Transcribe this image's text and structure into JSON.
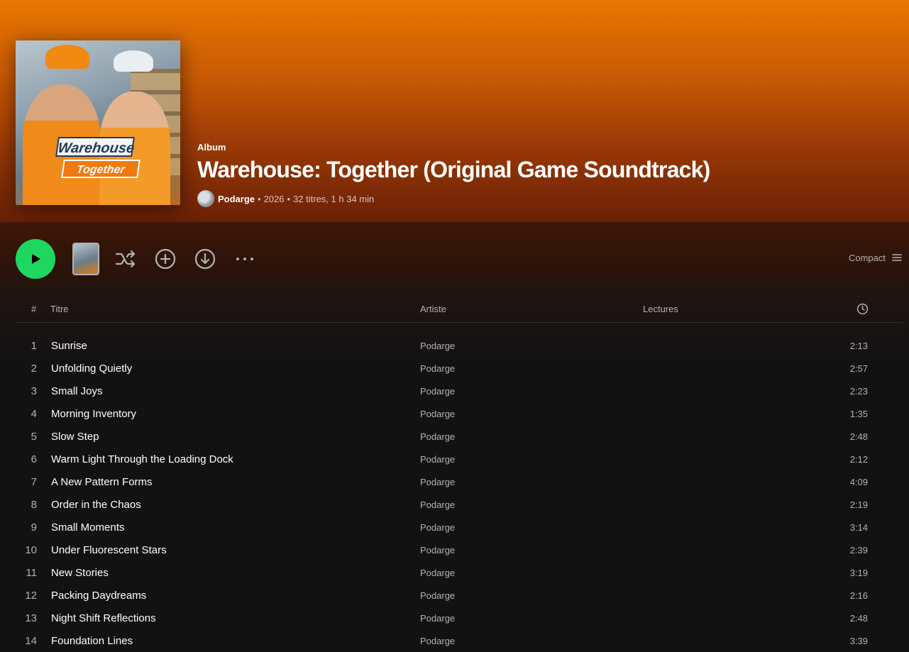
{
  "album": {
    "type_label": "Album",
    "title": "Warehouse: Together (Original Game Soundtrack)",
    "artist": "Podarge",
    "year": "2026",
    "summary": "32 titres, 1 h 34 min",
    "separator": "•",
    "cover_text_line1": "Warehouse",
    "cover_text_line2": "Together"
  },
  "actions": {
    "play_icon": "play-icon",
    "shuffle_icon": "shuffle-icon",
    "add_icon": "add-circle-icon",
    "download_icon": "download-icon",
    "more_icon": "more-horizontal-icon",
    "view_mode_label": "Compact",
    "accent_color": "#1ed760"
  },
  "table": {
    "headers": {
      "num": "#",
      "title": "Titre",
      "artist": "Artiste",
      "plays": "Lectures",
      "duration_icon": "clock-icon"
    },
    "tracks": [
      {
        "num": "1",
        "title": "Sunrise",
        "artist": "Podarge",
        "duration": "2:13"
      },
      {
        "num": "2",
        "title": "Unfolding Quietly",
        "artist": "Podarge",
        "duration": "2:57"
      },
      {
        "num": "3",
        "title": "Small Joys",
        "artist": "Podarge",
        "duration": "2:23"
      },
      {
        "num": "4",
        "title": "Morning Inventory",
        "artist": "Podarge",
        "duration": "1:35"
      },
      {
        "num": "5",
        "title": "Slow Step",
        "artist": "Podarge",
        "duration": "2:48"
      },
      {
        "num": "6",
        "title": "Warm Light Through the Loading Dock",
        "artist": "Podarge",
        "duration": "2:12"
      },
      {
        "num": "7",
        "title": "A New Pattern Forms",
        "artist": "Podarge",
        "duration": "4:09"
      },
      {
        "num": "8",
        "title": "Order in the Chaos",
        "artist": "Podarge",
        "duration": "2:19"
      },
      {
        "num": "9",
        "title": "Small Moments",
        "artist": "Podarge",
        "duration": "3:14"
      },
      {
        "num": "10",
        "title": "Under Fluorescent Stars",
        "artist": "Podarge",
        "duration": "2:39"
      },
      {
        "num": "11",
        "title": "New Stories",
        "artist": "Podarge",
        "duration": "3:19"
      },
      {
        "num": "12",
        "title": "Packing Daydreams",
        "artist": "Podarge",
        "duration": "2:16"
      },
      {
        "num": "13",
        "title": "Night Shift Reflections",
        "artist": "Podarge",
        "duration": "2:48"
      },
      {
        "num": "14",
        "title": "Foundation Lines",
        "artist": "Podarge",
        "duration": "3:39"
      }
    ]
  }
}
